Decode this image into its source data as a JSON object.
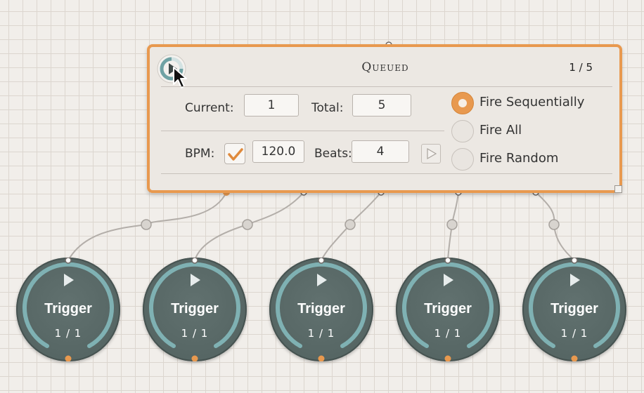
{
  "panel": {
    "title": "Queued",
    "counter": "1 / 5",
    "current_label": "Current:",
    "current_value": "1",
    "total_label": "Total:",
    "total_value": "5",
    "bpm_label": "BPM:",
    "bpm_checked": true,
    "bpm_value": "120.0",
    "beats_label": "Beats:",
    "beats_value": "4",
    "modes": [
      {
        "label": "Fire Sequentially",
        "selected": true
      },
      {
        "label": "Fire All",
        "selected": false
      },
      {
        "label": "Fire Random",
        "selected": false
      }
    ]
  },
  "triggers": [
    {
      "label": "Trigger",
      "count": "1 / 1"
    },
    {
      "label": "Trigger",
      "count": "1 / 1"
    },
    {
      "label": "Trigger",
      "count": "1 / 1"
    },
    {
      "label": "Trigger",
      "count": "1 / 1"
    },
    {
      "label": "Trigger",
      "count": "1 / 1"
    }
  ],
  "colors": {
    "accent": "#e8994f",
    "node": "#5b6b69",
    "ring": "#7fb1b3",
    "wire": "#b3aea9"
  },
  "icons": {
    "panel_icon": "progress-play-icon",
    "cursor": "mouse-pointer-icon",
    "checkbox": "checkmark-icon",
    "beat_play": "play-triangle-icon",
    "trigger_play": "play-triangle-icon"
  }
}
